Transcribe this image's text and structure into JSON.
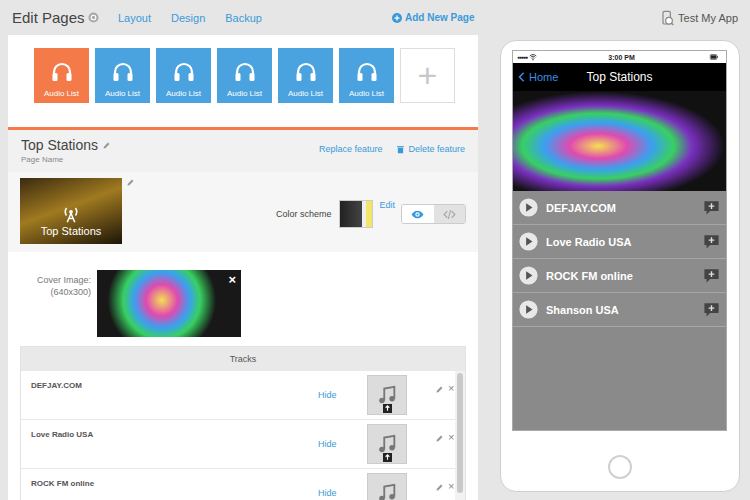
{
  "header": {
    "title": "Edit Pages",
    "tabs": [
      {
        "label": "Layout"
      },
      {
        "label": "Design"
      },
      {
        "label": "Backup"
      }
    ],
    "add_page": "Add New Page",
    "test_app": "Test My App"
  },
  "pages": [
    {
      "label": "Audio List",
      "selected": true
    },
    {
      "label": "Audio List",
      "selected": false
    },
    {
      "label": "Audio List",
      "selected": false
    },
    {
      "label": "Audio List",
      "selected": false
    },
    {
      "label": "Audio List",
      "selected": false
    },
    {
      "label": "Audio List",
      "selected": false
    }
  ],
  "add_tile": "+",
  "feature": {
    "page_name": "Top Stations",
    "page_name_label": "Page Name",
    "replace": "Replace feature",
    "delete": "Delete feature",
    "icon_label": "Top Stations",
    "color_scheme_label": "Color scheme",
    "color_scheme_edit": "Edit",
    "view_toggle": [
      {
        "kind": "eye",
        "selected": true
      },
      {
        "kind": "code",
        "selected": false
      }
    ]
  },
  "cover": {
    "label": "Cover Image:",
    "size": "(640x300)",
    "remove": "×"
  },
  "tracks": {
    "header": "Tracks",
    "rows": [
      {
        "title": "DEFJAY.COM",
        "hide": "Hide",
        "delete": "×"
      },
      {
        "title": "Love Radio USA",
        "hide": "Hide",
        "delete": "×"
      },
      {
        "title": "ROCK FM online",
        "hide": "Hide",
        "delete": "×"
      }
    ]
  },
  "phone": {
    "signal": "●●●●●",
    "time": "3:00 PM",
    "back": "Home",
    "title": "Top Stations",
    "stations": [
      {
        "name": "DEFJAY.COM"
      },
      {
        "name": "Love Radio USA"
      },
      {
        "name": "ROCK FM online"
      },
      {
        "name": "Shanson USA"
      }
    ]
  }
}
